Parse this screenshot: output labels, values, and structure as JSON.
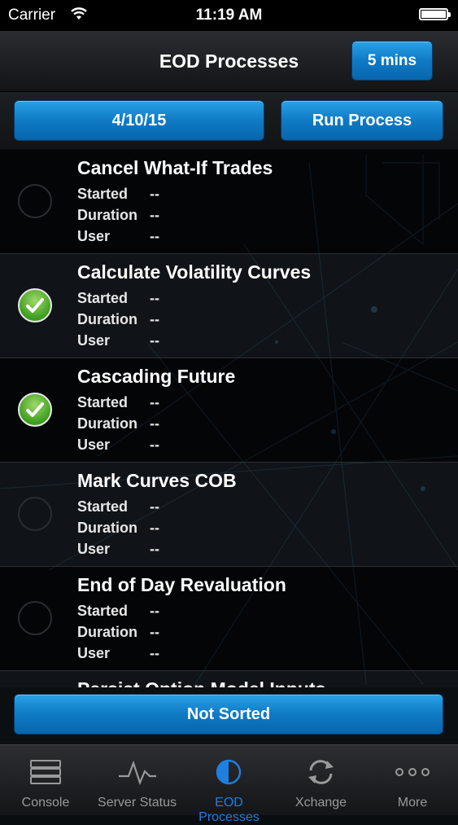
{
  "status": {
    "carrier": "Carrier",
    "time": "11:19 AM"
  },
  "nav": {
    "title": "EOD Processes",
    "interval": "5 mins"
  },
  "toolbar": {
    "date": "4/10/15",
    "run_label": "Run Process"
  },
  "field_labels": {
    "started": "Started",
    "duration": "Duration",
    "user": "User"
  },
  "processes": [
    {
      "name": "Cancel What-If Trades",
      "completed": false,
      "started": "--",
      "duration": "--",
      "user": "--"
    },
    {
      "name": "Calculate Volatility Curves",
      "completed": true,
      "started": "--",
      "duration": "--",
      "user": "--"
    },
    {
      "name": "Cascading Future",
      "completed": true,
      "started": "--",
      "duration": "--",
      "user": "--"
    },
    {
      "name": "Mark Curves COB",
      "completed": false,
      "started": "--",
      "duration": "--",
      "user": "--"
    },
    {
      "name": "End of Day Revaluation",
      "completed": false,
      "started": "--",
      "duration": "--",
      "user": "--"
    },
    {
      "name": "Persist Option Model Inputs",
      "completed": false,
      "started": "--",
      "duration": "--",
      "user": "--"
    }
  ],
  "sort": {
    "label": "Not Sorted"
  },
  "tabs": [
    {
      "label": "Console",
      "icon": "server-icon",
      "active": false
    },
    {
      "label": "Server Status",
      "icon": "pulse-icon",
      "active": false
    },
    {
      "label": "EOD Processes",
      "icon": "half-circle-icon",
      "active": true
    },
    {
      "label": "Xchange",
      "icon": "sync-icon",
      "active": false
    },
    {
      "label": "More",
      "icon": "more-icon",
      "active": false
    }
  ],
  "colors": {
    "accent": "#1e7fe0",
    "button": "#0f7ac4",
    "check": "#3c9d1e"
  }
}
